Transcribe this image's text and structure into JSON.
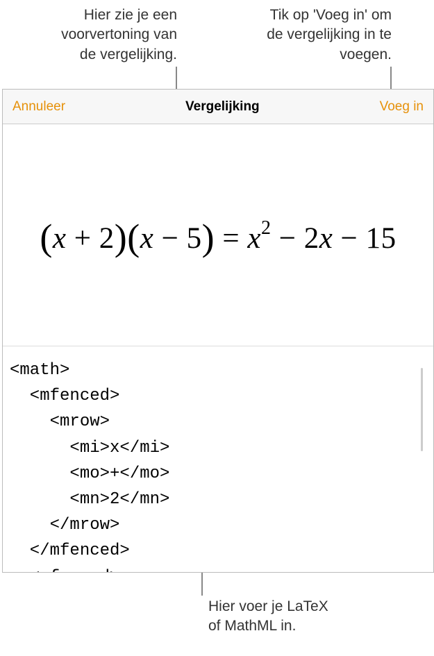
{
  "callouts": {
    "preview": "Hier zie je een\nvoorvertoning van\nde vergelijking.",
    "insert": "Tik op 'Voeg in' om\nde vergelijking in te\nvoegen.",
    "input": "Hier voer je LaTeX\nof MathML in."
  },
  "header": {
    "cancel": "Annuleer",
    "title": "Vergelijking",
    "insert": "Voeg in"
  },
  "equation": {
    "parts": {
      "lp1": "(",
      "x1": "x",
      "plus": " + ",
      "two": "2",
      "rp1": ")",
      "lp2": "(",
      "x2": "x",
      "minus1": " − ",
      "five": "5",
      "rp2": ")",
      "eq": " = ",
      "x3": "x",
      "sq": "2",
      "minus2": " − ",
      "twox": "2",
      "x4": "x",
      "minus3": " − ",
      "fifteen": "15"
    }
  },
  "code": "<math>\n  <mfenced>\n    <mrow>\n      <mi>x</mi>\n      <mo>+</mo>\n      <mn>2</mn>\n    </mrow>\n  </mfenced>\n  <mfenced>\n    <mrow>"
}
